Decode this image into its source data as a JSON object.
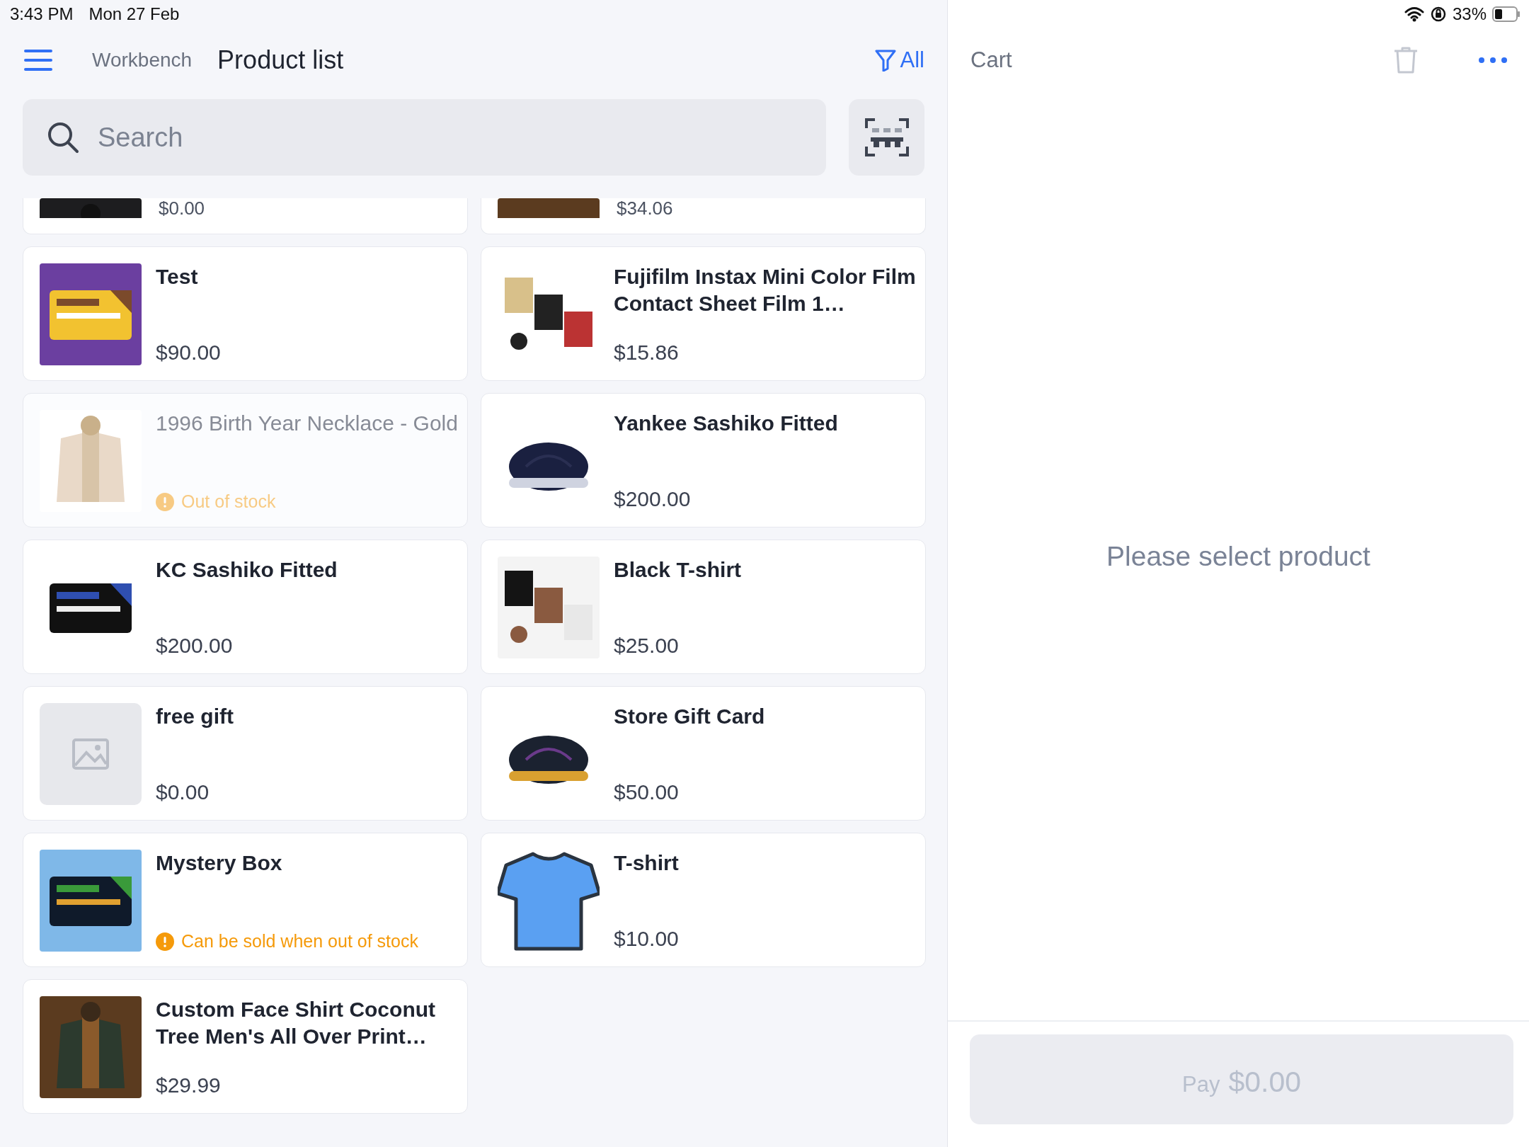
{
  "status_bar": {
    "time": "3:43 PM",
    "date": "Mon 27 Feb",
    "battery": "33%"
  },
  "header": {
    "breadcrumb": "Workbench",
    "title": "Product list",
    "filter": "All"
  },
  "search": {
    "placeholder": "Search"
  },
  "partial_products": [
    {
      "price": "$0.00"
    },
    {
      "price": "$34.06"
    }
  ],
  "products": [
    {
      "name": "Test",
      "price": "$90.00",
      "kind": "picture",
      "available": true
    },
    {
      "name": "Fujifilm Instax Mini Color Film Contact Sheet Film 1…",
      "price": "$15.86",
      "kind": "picture",
      "available": true
    },
    {
      "name": "1996 Birth Year Necklace - Gold",
      "kind": "picture",
      "available": false,
      "notice": {
        "text": "Out of stock",
        "kind": "out_of_stock"
      }
    },
    {
      "name": "Yankee Sashiko Fitted",
      "price": "$200.00",
      "kind": "picture",
      "available": true
    },
    {
      "name": "KC Sashiko Fitted",
      "price": "$200.00",
      "kind": "picture",
      "available": true
    },
    {
      "name": "Black T-shirt",
      "price": "$25.00",
      "kind": "picture",
      "available": true
    },
    {
      "name": "free gift",
      "price": "$0.00",
      "kind": "placeholder",
      "available": true
    },
    {
      "name": "Store Gift Card",
      "price": "$50.00",
      "kind": "picture",
      "available": true
    },
    {
      "name": "Mystery Box",
      "kind": "picture",
      "available": true,
      "notice": {
        "text": "Can be sold when out of stock",
        "kind": "oversell"
      }
    },
    {
      "name": "T-shirt",
      "price": "$10.00",
      "kind": "icon",
      "available": true
    },
    {
      "name": "Custom Face Shirt Coconut Tree Men's All Over Print…",
      "price": "$29.99",
      "kind": "picture",
      "available": true
    }
  ],
  "cart": {
    "title": "Cart",
    "empty_message": "Please select product",
    "pay_label": "Pay",
    "pay_amount": "$0.00"
  }
}
